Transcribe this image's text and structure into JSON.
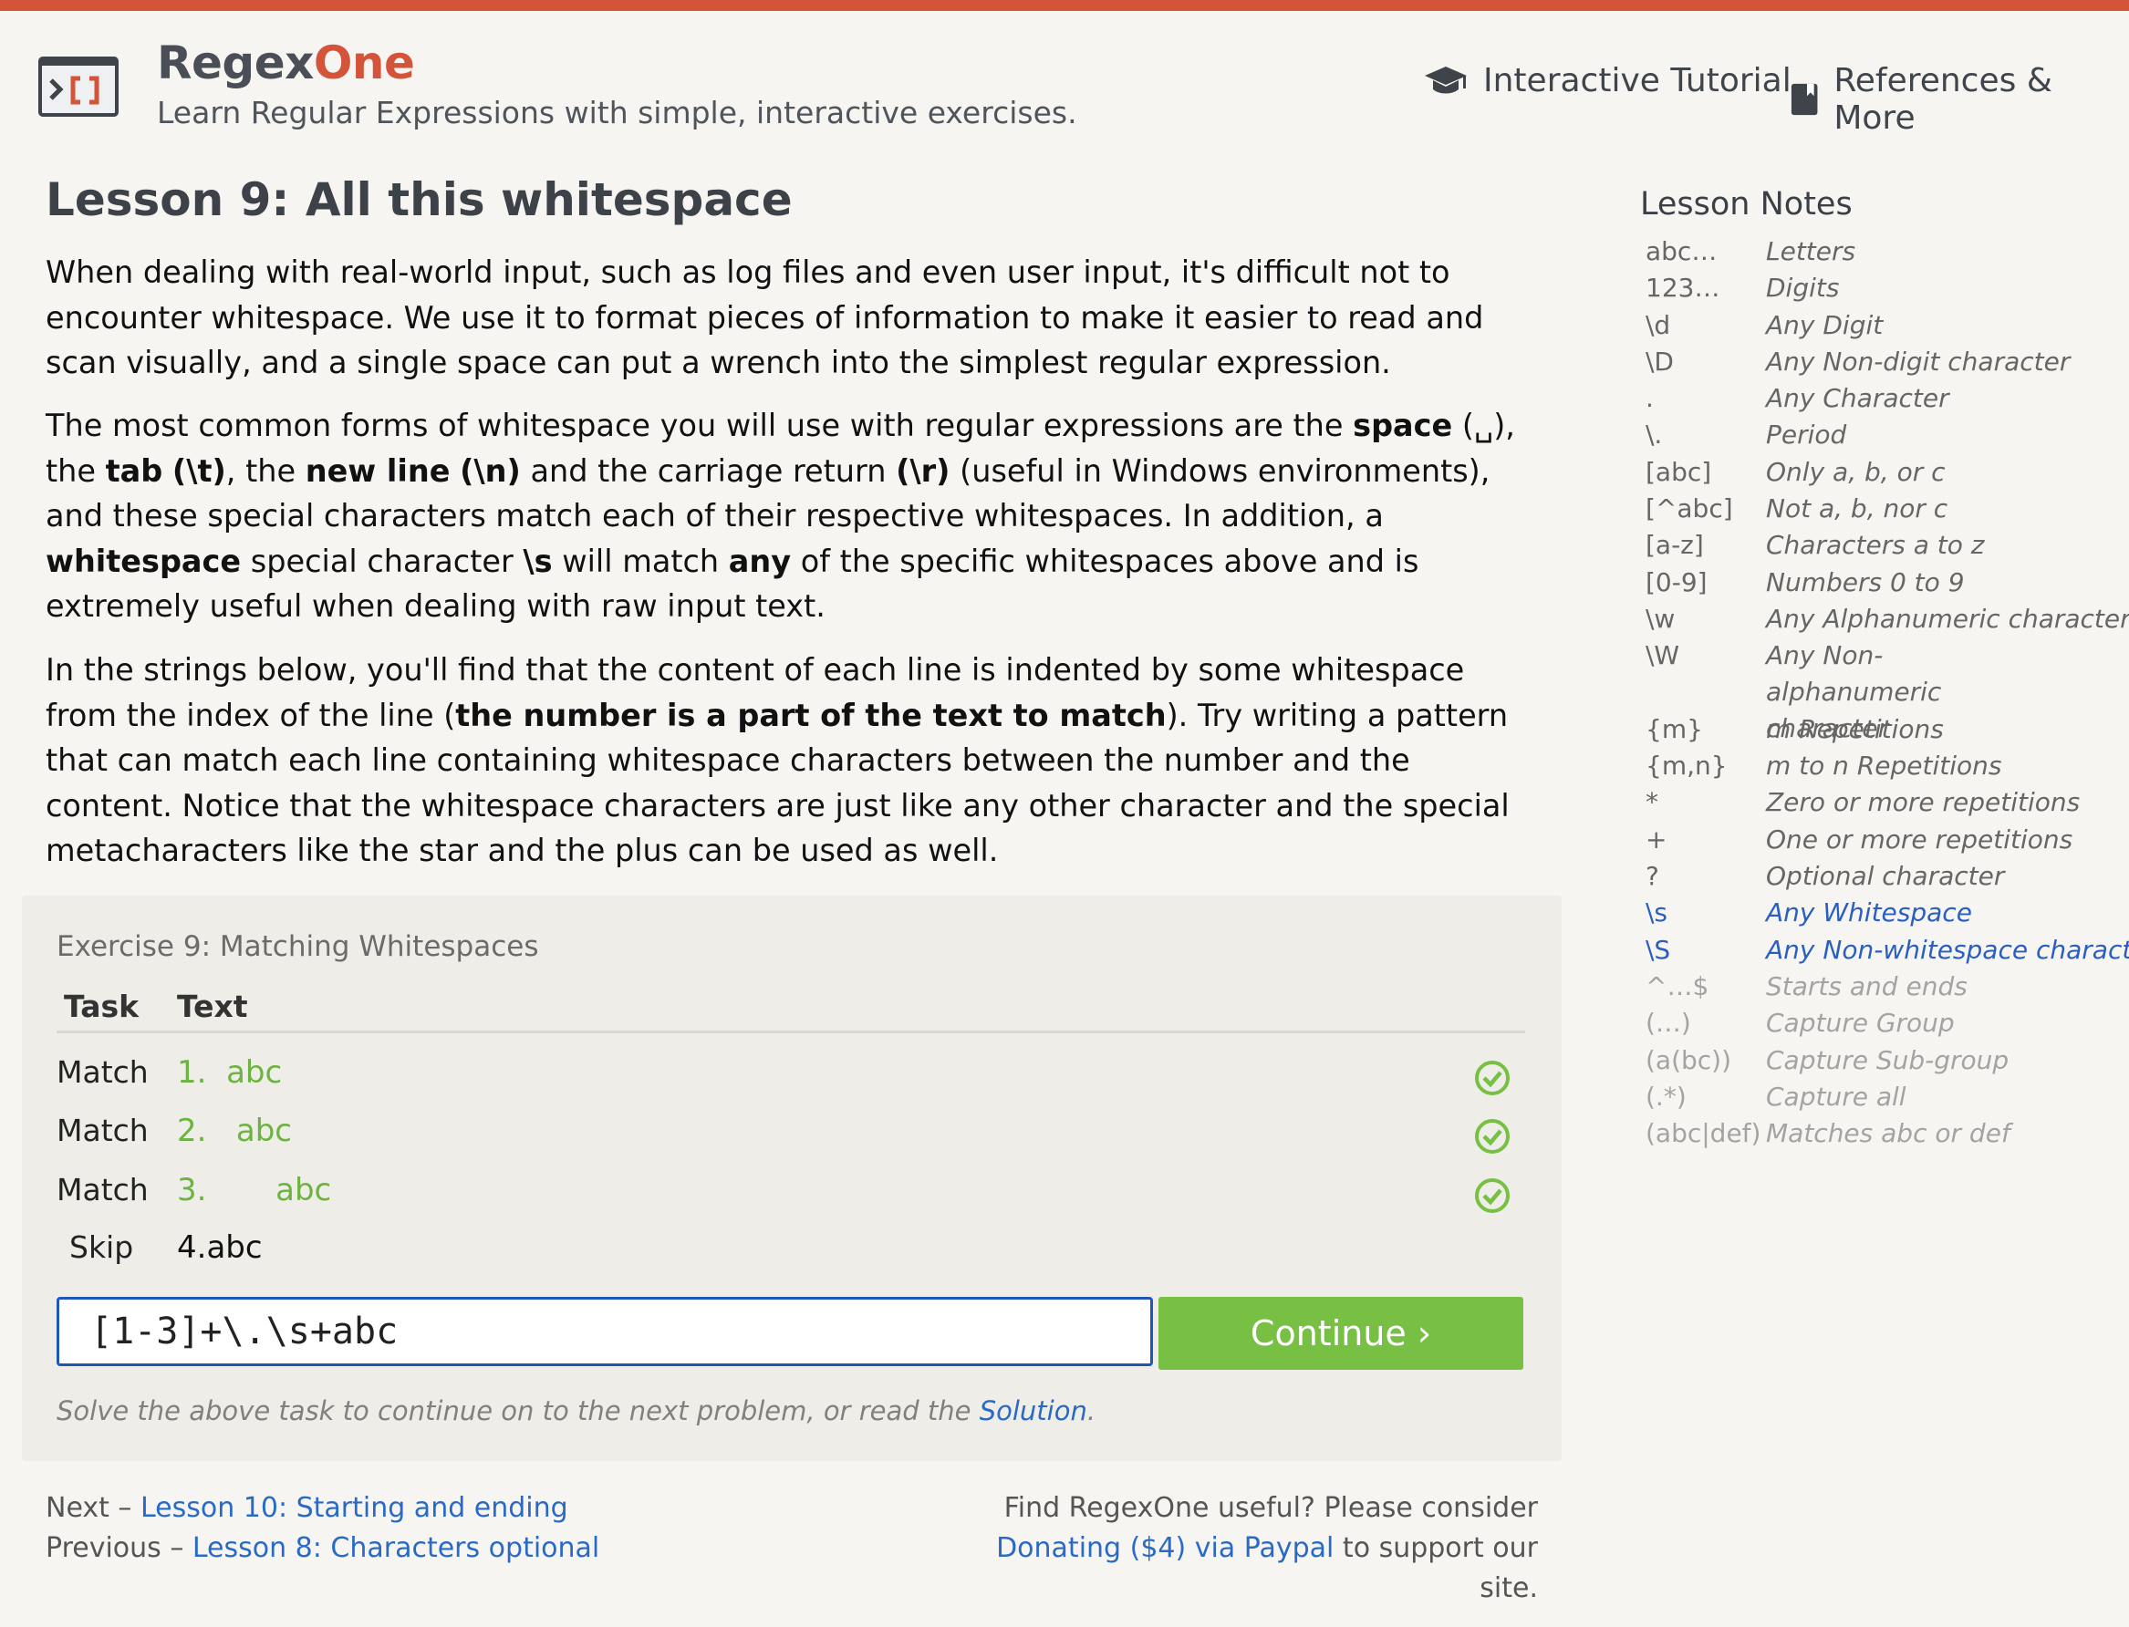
{
  "header": {
    "brand_main": "Regex",
    "brand_accent": "One",
    "tagline": "Learn Regular Expressions with simple, interactive exercises.",
    "nav_tutorial": "Interactive Tutorial",
    "nav_references": "References & More"
  },
  "lesson": {
    "title": "Lesson 9: All this whitespace",
    "p1": "When dealing with real-world input, such as log files and even user input, it's difficult not to encounter whitespace. We use it to format pieces of information to make it easier to read and scan visually, and a single space can put a wrench into the simplest regular expression.",
    "p2": {
      "a": "The most common forms of whitespace you will use with regular expressions are the ",
      "space": "space",
      "b": " (␣), the ",
      "tab": "tab",
      "c": " ",
      "tab_code": "(\\t)",
      "d": ", the ",
      "newline": "new line",
      "e": " ",
      "newline_code": "(\\n)",
      "f": " and the carriage return ",
      "cr_code": "(\\r)",
      "g": " (useful in Windows environments), and these special characters match each of their respective whitespaces. In addition, a ",
      "ws": "whitespace",
      "h": " special character ",
      "ws_code": "\\s",
      "i": " will match ",
      "any": "any",
      "j": " of the specific whitespaces above and is extremely useful when dealing with raw input text."
    },
    "p3": {
      "a": "In the strings below, you'll find that the content of each line is indented by some whitespace from the index of the line (",
      "bold": "the number is a part of the text to match",
      "b": "). Try writing a pattern that can match each line containing whitespace characters between the number and the content. Notice that the whitespace characters are just like any other character and the special metacharacters like the star and the plus can be used as well."
    }
  },
  "exercise": {
    "title": "Exercise 9: Matching Whitespaces",
    "col_task": "Task",
    "col_text": "Text",
    "rows": [
      {
        "task": "Match",
        "num": "1.",
        "gap": "  ",
        "content": "abc",
        "status": "matched"
      },
      {
        "task": "Match",
        "num": "2.",
        "gap": "   ",
        "content": "abc",
        "status": "matched"
      },
      {
        "task": "Match",
        "num": "3.",
        "gap": "       ",
        "content": "abc",
        "status": "matched"
      },
      {
        "task": "Skip",
        "num": "4.",
        "gap": "",
        "content": "abc",
        "status": "none"
      }
    ],
    "input_value": "[1-3]+\\.\\s+abc",
    "continue_label": "Continue ›",
    "hint_text": "Solve the above task to continue on to the next problem, or read the ",
    "hint_link": "Solution",
    "hint_end": ".",
    "success_color": "#77c043"
  },
  "footer": {
    "next_label": "Next – ",
    "next_link": "Lesson 10: Starting and ending",
    "prev_label": "Previous – ",
    "prev_link": "Lesson 8: Characters optional",
    "donate_line1": "Find RegexOne useful? Please consider",
    "donate_link": "Donating ($4) via Paypal",
    "donate_end": " to support our site."
  },
  "notes": {
    "title": "Lesson Notes",
    "items": [
      {
        "k": "abc…",
        "v": "Letters",
        "state": "done"
      },
      {
        "k": "123…",
        "v": "Digits",
        "state": "done"
      },
      {
        "k": "\\d",
        "v": "Any Digit",
        "state": "done"
      },
      {
        "k": "\\D",
        "v": "Any Non-digit character",
        "state": "done"
      },
      {
        "k": ".",
        "v": "Any Character",
        "state": "done"
      },
      {
        "k": "\\.",
        "v": "Period",
        "state": "done"
      },
      {
        "k": "[abc]",
        "v": "Only a, b, or c",
        "state": "done"
      },
      {
        "k": "[^abc]",
        "v": "Not a, b, nor c",
        "state": "done"
      },
      {
        "k": "[a-z]",
        "v": "Characters a to z",
        "state": "done"
      },
      {
        "k": "[0-9]",
        "v": "Numbers 0 to 9",
        "state": "done"
      },
      {
        "k": "\\w",
        "v": "Any Alphanumeric character",
        "state": "done"
      },
      {
        "k": "\\W",
        "v": "Any Non-alphanumeric character",
        "state": "done"
      },
      {
        "k": "{m}",
        "v": "m Repetitions",
        "state": "done"
      },
      {
        "k": "{m,n}",
        "v": "m to n Repetitions",
        "state": "done"
      },
      {
        "k": "*",
        "v": "Zero or more repetitions",
        "state": "done"
      },
      {
        "k": "+",
        "v": "One or more repetitions",
        "state": "done"
      },
      {
        "k": "?",
        "v": "Optional character",
        "state": "done"
      },
      {
        "k": "\\s",
        "v": "Any Whitespace",
        "state": "active"
      },
      {
        "k": "\\S",
        "v": "Any Non-whitespace character",
        "state": "active"
      },
      {
        "k": "^…$",
        "v": "Starts and ends",
        "state": "future"
      },
      {
        "k": "(…)",
        "v": "Capture Group",
        "state": "future"
      },
      {
        "k": "(a(bc))",
        "v": "Capture Sub-group",
        "state": "future"
      },
      {
        "k": "(.*)",
        "v": "Capture all",
        "state": "future"
      },
      {
        "k": "(abc|def)",
        "v": "Matches abc or def",
        "state": "future"
      }
    ]
  },
  "colors": {
    "accent": "#d4543a",
    "link": "#2a6ac7",
    "success": "#77c043",
    "match_text": "#6cb43f"
  }
}
